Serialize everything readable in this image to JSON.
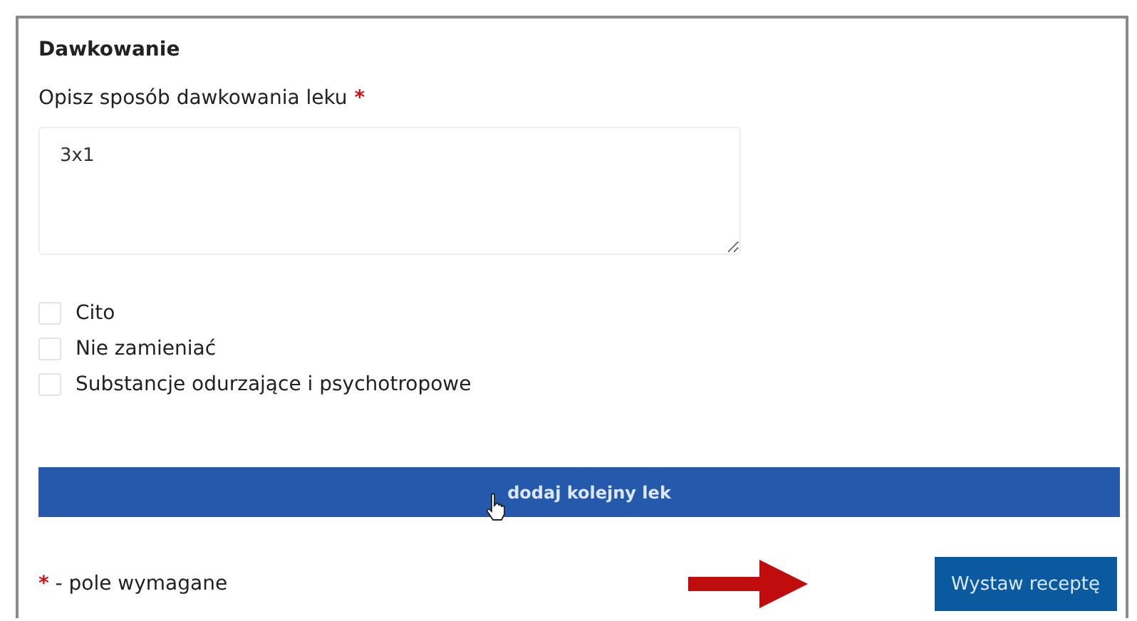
{
  "section": {
    "title": "Dawkowanie"
  },
  "dosage_field": {
    "label": "Opisz sposób dawkowania leku",
    "required": true,
    "value": "3x1"
  },
  "checkboxes": [
    {
      "label": "Cito",
      "checked": false
    },
    {
      "label": "Nie zamieniać",
      "checked": false
    },
    {
      "label": "Substancje odurzające i psychotropowe",
      "checked": false
    }
  ],
  "add_button": {
    "label": "dodaj kolejny lek"
  },
  "required_note": {
    "mark": "*",
    "text": "- pole wymagane"
  },
  "submit_button": {
    "label": "Wystaw receptę"
  }
}
